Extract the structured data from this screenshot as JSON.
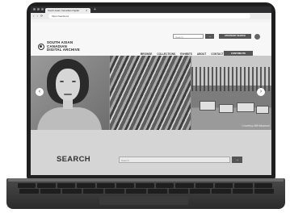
{
  "browser": {
    "tab_title": "South Asian Canadian Digital",
    "tab_close": "×",
    "new_tab": "+",
    "nav_buttons": "‹ › ⟳",
    "url": "https://sacda.ca"
  },
  "site": {
    "logo_line1": "SOUTH ASIAN",
    "logo_line2": "CANADIAN",
    "logo_line3": "DIGITAL ARCHIVE",
    "search_placeholder": "Search",
    "search_button": "→",
    "advanced_search_button": "ADVANCED SEARCH",
    "nav": [
      "BROWSE",
      "COLLECTIONS",
      "EXHIBITS",
      "ABOUT",
      "CONTACT"
    ],
    "contribute_button": "CONTRIBUTE"
  },
  "hero": {
    "photo3_credit": "Courtesy Mill Museum",
    "prev_arrow": "‹",
    "next_arrow": "›"
  },
  "search_section": {
    "title": "SEARCH",
    "placeholder": "Search",
    "button": "→"
  },
  "colors": {
    "bezel": "#1f1f20",
    "page_bg": "#d5d5d5",
    "button_bg": "#555555"
  }
}
